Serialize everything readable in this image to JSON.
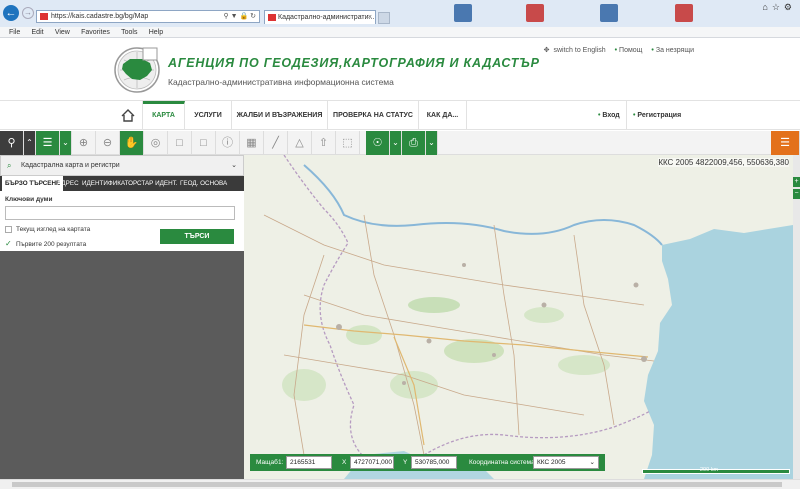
{
  "browser": {
    "url": "https://kais.cadastre.bg/bg/Map",
    "tab_title": "Кадастрално-администрати...",
    "menu": [
      "File",
      "Edit",
      "View",
      "Favorites",
      "Tools",
      "Help"
    ]
  },
  "header": {
    "agency_title": "АГЕНЦИЯ ПО ГЕОДЕЗИЯ,КАРТОГРАФИЯ И КАДАСТЪР",
    "agency_subtitle": "Кадастрално-административна информационна система",
    "switch_lang": "switch to English",
    "help": "Помощ",
    "visually_impaired": "За незрящи"
  },
  "nav": {
    "items": [
      "КАРТА",
      "УСЛУГИ",
      "ЖАЛБИ И ВЪЗРАЖЕНИЯ",
      "ПРОВЕРКА НА СТАТУС",
      "КАК ДА..."
    ],
    "login": "Вход",
    "register": "Регистрация"
  },
  "sidebar": {
    "layer": "Кадастрална карта и регистри",
    "tabs": [
      "БЪРЗО ТЪРСЕНЕ",
      "АДРЕС",
      "ИДЕНТИФИКАТОР",
      "СТАР ИДЕНТ.",
      "ГЕОД. ОСНОВА"
    ],
    "keywords_label": "Ключови думи",
    "keywords_value": "",
    "current_view_label": "Текущ изглед на картата",
    "first_200_label": "Първите 200 резултата",
    "search_button": "ТЪРСИ"
  },
  "map": {
    "coordinates": "ККС 2005 4822009,456, 550636,380",
    "scale_label": "Мащаб",
    "scale_prefix": "1:",
    "scale_value": "2165531",
    "x_label": "X",
    "x_value": "4727071,000",
    "y_label": "Y",
    "y_value": "530785,000",
    "crs_label": "Координатна система",
    "crs_value": "ККС 2005",
    "scale_bar": "200 km"
  },
  "colors": {
    "brand_green": "#2a8a3f",
    "orange": "#e3711b",
    "sea": "#aad3df"
  }
}
